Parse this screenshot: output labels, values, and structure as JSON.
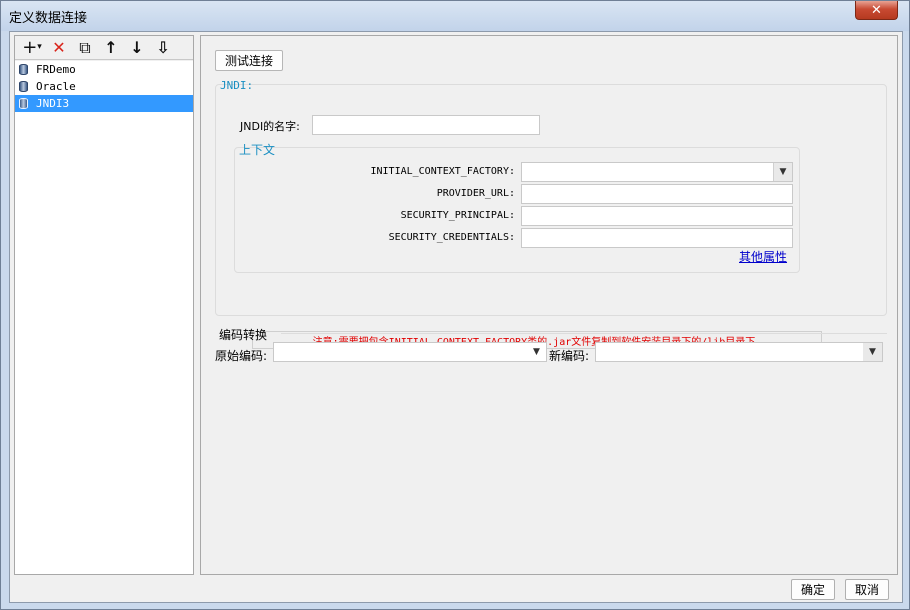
{
  "window": {
    "title": "定义数据连接",
    "close_glyph": "✕"
  },
  "toolbar": {
    "add_icon": "+",
    "add_dropdown": "▾",
    "delete_icon": "✕",
    "copy_icon": "⧉",
    "up_icon": "↑",
    "down_icon": "↓",
    "sort_icon": "⇩"
  },
  "connections": [
    {
      "name": "FRDemo",
      "selected": false
    },
    {
      "name": "Oracle",
      "selected": false
    },
    {
      "name": "JNDI3",
      "selected": true
    }
  ],
  "test_button": "测试连接",
  "jndi": {
    "group_title": "JNDI:",
    "name_label": "JNDI的名字:",
    "name_value": "",
    "context_title": "上下文",
    "fields": [
      {
        "label": "INITIAL_CONTEXT_FACTORY:",
        "value": "",
        "type": "combo"
      },
      {
        "label": "PROVIDER_URL:",
        "value": "",
        "type": "text"
      },
      {
        "label": "SECURITY_PRINCIPAL:",
        "value": "",
        "type": "text"
      },
      {
        "label": "SECURITY_CREDENTIALS:",
        "value": "",
        "type": "text"
      }
    ],
    "other_props_link": "其他属性",
    "note": "注意:需要把包含INITIAL_CONTEXT_FACTORY类的.jar文件复制到软件安装目录下的/lib目录下."
  },
  "encoding": {
    "title": "编码转换",
    "original_label": "原始编码:",
    "original_value": "",
    "new_label": "新编码:",
    "new_value": ""
  },
  "footer": {
    "ok_label": "确定",
    "cancel_label": "取消"
  },
  "colors": {
    "selection": "#3399ff",
    "group_title": "#1a8fc2",
    "note_text": "#e00000",
    "link": "#0000cc"
  }
}
